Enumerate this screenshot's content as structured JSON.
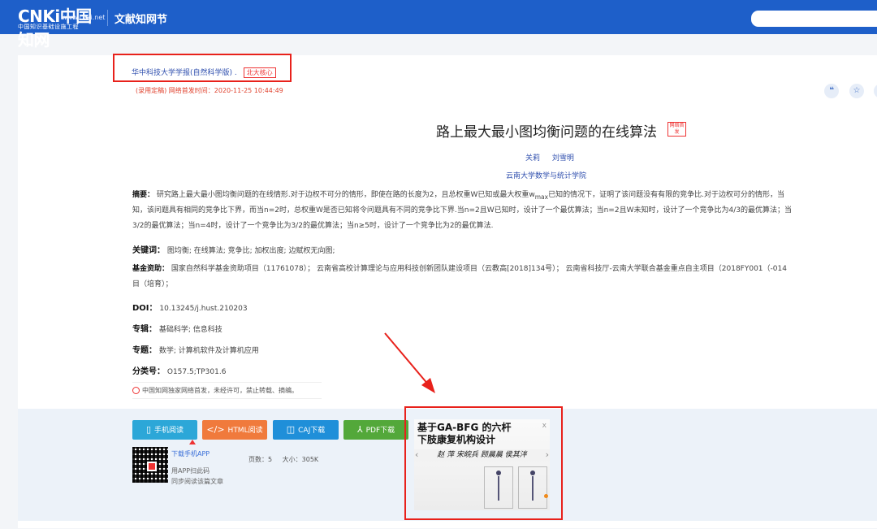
{
  "header": {
    "logo_main": "CNKi中国知网",
    "logo_url": "www.cnki.net",
    "logo_sub": "中国知识基础设施工程",
    "site_name": "文献知网节"
  },
  "article": {
    "journal": "华中科技大学学报(自然科学版)",
    "journal_sep": ".",
    "journal_tag": "北大核心",
    "pub_time": "(录用定稿) 网络首发时间：2020-11-25 10:44:49",
    "tools": [
      "❝",
      "☆"
    ],
    "title": "路上最大最小图均衡问题的在线算法",
    "title_badge": "网络首发",
    "authors": [
      "关莉",
      "刘雪明"
    ],
    "affiliation": "云南大学数学与统计学院",
    "abstract_label": "摘要：",
    "abstract_lines": [
      "研究路上最大最小图均衡问题的在线情形.对于边权不可分的情形，即使在路的长度为2，且总权重W已知或最大权重w",
      "知，该问题具有相同的竞争比下界，而当n=2时，总权重W是否已知将令问题具有不同的竞争比下界.当n=2且W已知时，设计了一个最优算法；当n=2且W未知时，设计了一个竞争比为4/3的最优算法；当",
      "3/2的最优算法；当n=4时，设计了一个竞争比为3/2的最优算法；当n≥5时，设计了一个竞争比为2的最优算法."
    ],
    "abstract_sub": "max",
    "abstract_line1_tail": "已知的情况下，证明了该问题没有有限的竞争比.对于边权可分的情形，当",
    "keywords_label": "关键词：",
    "keywords": "图均衡;  在线算法;  竞争比;  加权出度;  边赋权无向图;",
    "fund_label": "基金资助：",
    "fund_line1": "国家自然科学基金资助项目（11761078）；  云南省高校计算理论与应用科技创新团队建设项目（云教高[2018]134号）；  云南省科技厅-云南大学联合基金重点自主项目（2018FY001（-014",
    "fund_line2": "目（培育）；",
    "doi_label": "DOI：",
    "doi": "10.13245/j.hust.210203",
    "album_label": "专辑：",
    "album": "基础科学; 信息科技",
    "topic_label": "专题：",
    "topic": "数学; 计算机软件及计算机应用",
    "class_label": "分类号：",
    "class_no": "O157.5;TP301.6",
    "notice": "中国知网独家网络首发，未经许可，禁止转载、摘编。"
  },
  "downloads": {
    "mobile": "手机阅读",
    "html": "HTML阅读",
    "caj": "CAJ下载",
    "pdf": "PDF下载",
    "app_link": "下载手机APP",
    "app_desc1": "用APP扫此码",
    "app_desc2": "同步阅读该篇文章",
    "pages": "页数：5",
    "size": "大小：305K"
  },
  "ad": {
    "title_line1": "基于GA-BFG 的六杆",
    "title_line2": "下肢康复机构设计",
    "names": "赵  萍  宋皖兵  顾晨晨  侯其泮",
    "close": "x"
  },
  "colors": {
    "brand": "#1e5fc9",
    "highlight": "#e8211b"
  }
}
